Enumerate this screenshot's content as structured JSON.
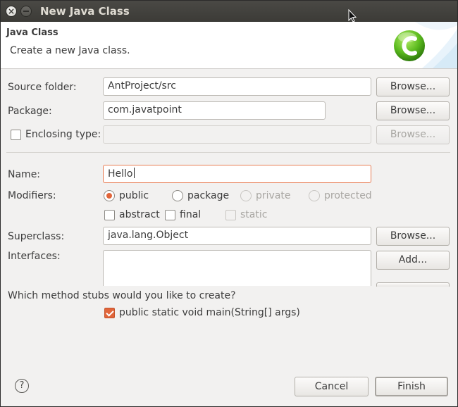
{
  "window": {
    "title": "New Java Class"
  },
  "banner": {
    "title": "Java Class",
    "description": "Create a new Java class."
  },
  "form": {
    "source_folder": {
      "label": "Source folder:",
      "value": "AntProject/src",
      "button": "Browse..."
    },
    "package": {
      "label": "Package:",
      "value": "com.javatpoint",
      "button": "Browse..."
    },
    "enclosing_type": {
      "label": "Enclosing type:",
      "value": "",
      "button": "Browse...",
      "checked": false
    },
    "name": {
      "label": "Name:",
      "value": "Hello"
    },
    "modifiers": {
      "label": "Modifiers:",
      "options": [
        "public",
        "package",
        "private",
        "protected"
      ],
      "selected": "public",
      "extras": [
        "abstract",
        "final",
        "static"
      ]
    },
    "superclass": {
      "label": "Superclass:",
      "value": "java.lang.Object",
      "button": "Browse..."
    },
    "interfaces": {
      "label": "Interfaces:",
      "add_button": "Add..."
    },
    "stubs": {
      "question": "Which method stubs would you like to create?",
      "main_label": "public static void main(String[] args)",
      "main_checked": true
    }
  },
  "footer": {
    "help": "?",
    "cancel": "Cancel",
    "finish": "Finish"
  },
  "colors": {
    "accent": "#e1653a",
    "titlebar": "#3c3b37",
    "dialog_bg": "#f2f1f0"
  }
}
